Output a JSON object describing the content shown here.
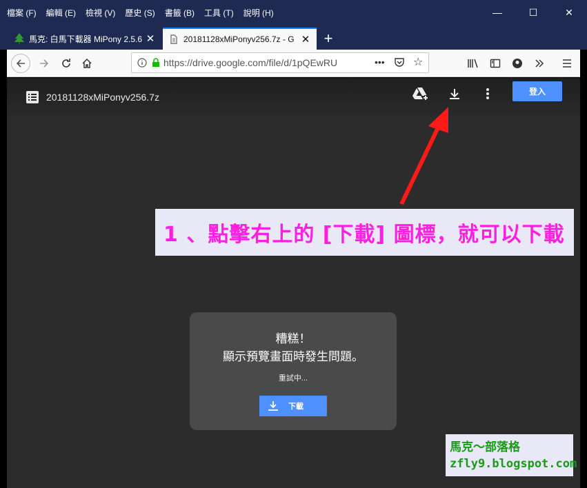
{
  "menubar": {
    "items": [
      "檔案 (F)",
      "編輯 (E)",
      "檢視 (V)",
      "歷史 (S)",
      "書籤 (B)",
      "工具 (T)",
      "說明 (H)"
    ]
  },
  "window_controls": {
    "minimize": "—",
    "maximize": "☐",
    "close": "✕"
  },
  "tabs": [
    {
      "title": "馬克: 白馬下載器 MiPony 2.5.6",
      "icon": "tree-icon",
      "close": "✕"
    },
    {
      "title": "20181128xMiPonyv256.7z - G",
      "icon": "drive-favicon-icon",
      "close": "✕"
    }
  ],
  "new_tab": "+",
  "url": "https://drive.google.com/file/d/1pQEwRU",
  "url_dots": "•••",
  "drive": {
    "file_name": "20181128xMiPonyv256.7z",
    "signin_label": "登入"
  },
  "callout": {
    "text": "1 、點擊右上的 [下載] 圖標，就可以下載"
  },
  "error": {
    "title": "糟糕！",
    "message": "顯示預覽畫面時發生問題。",
    "retry": "重試中...",
    "download_label": "下載"
  },
  "watermark": {
    "line1": "馬克～部落格",
    "line2": "zfly9.blogspot.com"
  },
  "colors": {
    "menubar_bg": "#1e2a52",
    "accent_blue": "#4d90fe",
    "callout_text": "#ff1fe0",
    "arrow_red": "#ff1a1a",
    "watermark_text": "#1a9b1a"
  }
}
